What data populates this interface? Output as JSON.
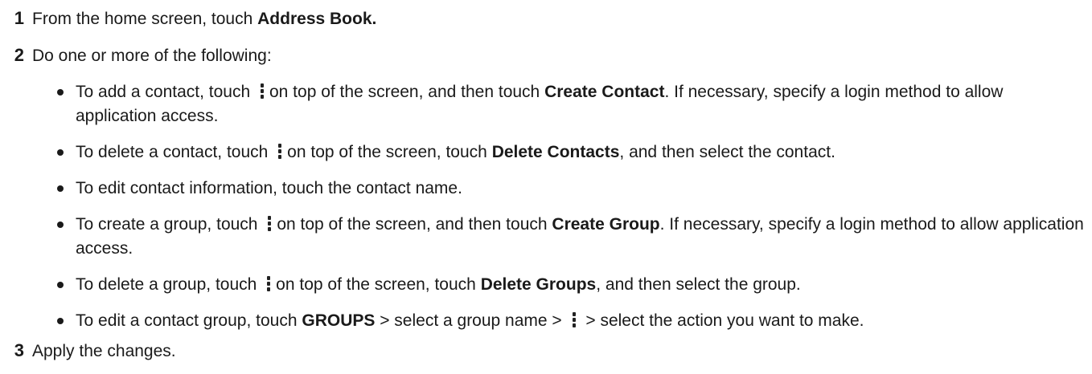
{
  "steps": [
    {
      "number": "1",
      "text_before": "From the home screen, touch ",
      "bold": "Address Book."
    },
    {
      "number": "2",
      "text": "Do one or more of the following:"
    },
    {
      "number": "3",
      "text": "Apply the changes."
    }
  ],
  "bullets": [
    {
      "part1": "To add a contact, touch ",
      "icon": "kebab-menu-icon",
      "part2": "on top of the screen, and then touch ",
      "bold": "Create Contact",
      "part3": ". If necessary, specify a login method to allow application access."
    },
    {
      "part1": "To delete a contact, touch ",
      "icon": "kebab-menu-icon",
      "part2": "on top of the screen, touch ",
      "bold": "Delete Contacts",
      "part3": ", and then select the contact."
    },
    {
      "text": "To edit contact information, touch the contact name."
    },
    {
      "part1": "To create a group, touch ",
      "icon": "kebab-menu-icon",
      "part2": "on top of the screen, and then touch ",
      "bold": "Create Group",
      "part3": ". If necessary, specify a login method to allow application access."
    },
    {
      "part1": "To delete a group, touch ",
      "icon": "kebab-menu-icon",
      "part2": "on top of the screen, touch ",
      "bold": "Delete Groups",
      "part3": ", and then select the group."
    },
    {
      "part1": "To edit a contact group, touch ",
      "bold": "GROUPS",
      "part2": " > select a group name > ",
      "icon": "kebab-menu-icon",
      "part3": " > select the action you want to make."
    }
  ]
}
